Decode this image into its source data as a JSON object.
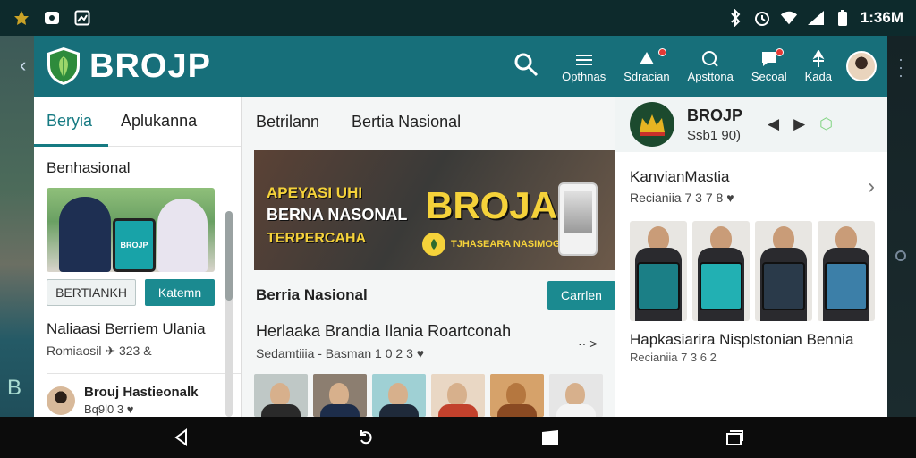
{
  "status_bar": {
    "time": "1:36M"
  },
  "app": {
    "title": "BROJP",
    "search_label": "search",
    "nav_actions": [
      {
        "label": "Opthnas",
        "icon": "menu-icon"
      },
      {
        "label": "Sdracian",
        "icon": "notification-icon"
      },
      {
        "label": "Apsttona",
        "icon": "search-icon"
      },
      {
        "label": "Secoal",
        "icon": "chat-icon"
      },
      {
        "label": "Kada",
        "icon": "pin-icon"
      }
    ]
  },
  "left_panel": {
    "tabs": [
      "Beryia",
      "Aplukanna"
    ],
    "section_title": "Benhasional",
    "image_label": "BROJP",
    "buttons": {
      "outline": "BERTIANKH",
      "primary": "Katemn"
    },
    "story": {
      "title": "Naliaasi Berriem Ulania",
      "meta": "Romiaosil ✈ 323 &"
    },
    "row": {
      "title": "Brouj Hastieonalk",
      "meta": "Bq9l0 3"
    }
  },
  "middle_panel": {
    "tabs": [
      "Betrilann",
      "Bertia Nasional"
    ],
    "hero": {
      "line1": "APEYASI UHI",
      "line2": "BERNA NASONAL",
      "line3": "TERPERCAHA",
      "brand": "BROJA",
      "sub": "TJHASEARA NASIMOGAI"
    },
    "section_title": "Berria Nasional",
    "section_button": "Carrlen",
    "story": {
      "title": "Herlaaka Brandia Ilania Roartconah",
      "meta": "Sedamtiiia - Basman 1 0 2 3"
    },
    "share": "·· >"
  },
  "right_panel": {
    "channel": {
      "title": "BROJP",
      "sub": "Ssb1 90)"
    },
    "item": {
      "title": "KanvianMastia",
      "meta": "Recianiia 7 3 7 8"
    },
    "caption": "Hapkasiarira Nisplstonian Bennia",
    "caption_meta": "Recianiia 7 3 6 2"
  },
  "colors": {
    "primary": "#176f7a",
    "accent": "#1b8a90",
    "status_bar": "#0d2a2c",
    "gold": "#f5d23a"
  }
}
